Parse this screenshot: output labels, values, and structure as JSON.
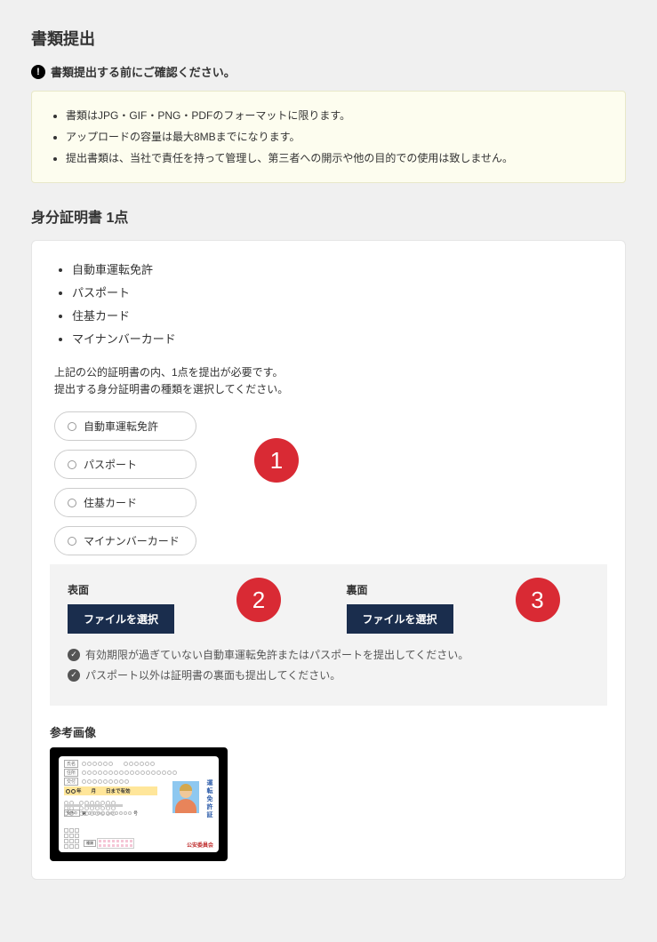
{
  "page": {
    "title": "書類提出",
    "warning_text": "書類提出する前にご確認ください。"
  },
  "info_notes": [
    "書類はJPG・GIF・PNG・PDFのフォーマットに限ります。",
    "アップロードの容量は最大8MBまでになります。",
    "提出書類は、当社で責任を持って管理し、第三者への開示や他の目的での使用は致しません。"
  ],
  "section": {
    "title": "身分証明書 1点"
  },
  "doc_types": [
    "自動車運転免許",
    "パスポート",
    "住基カード",
    "マイナンバーカード"
  ],
  "instruction_line1": "上記の公的証明書の内、1点を提出が必要です。",
  "instruction_line2": "提出する身分証明書の種類を選択してください。",
  "radio_options": [
    "自動車運転免許",
    "パスポート",
    "住基カード",
    "マイナンバーカード"
  ],
  "badges": {
    "b1": "1",
    "b2": "2",
    "b3": "3"
  },
  "upload": {
    "front_label": "表面",
    "back_label": "裏面",
    "button_label": "ファイルを選択"
  },
  "check_notes": [
    "有効期限が過ぎていない自動車運転免許またはパスポートを提出してください。",
    "パスポート以外は証明書の裏面も提出してください。"
  ],
  "reference": {
    "title": "参考画像",
    "license": {
      "name_label": "氏名",
      "address_label": "住所",
      "issue_label": "交付",
      "valid_text": "年　　月　　日まで有効",
      "license_number_label": "免許の",
      "vert_text": "運転免許証",
      "authority": "公安委員会",
      "type_label": "種類"
    }
  }
}
